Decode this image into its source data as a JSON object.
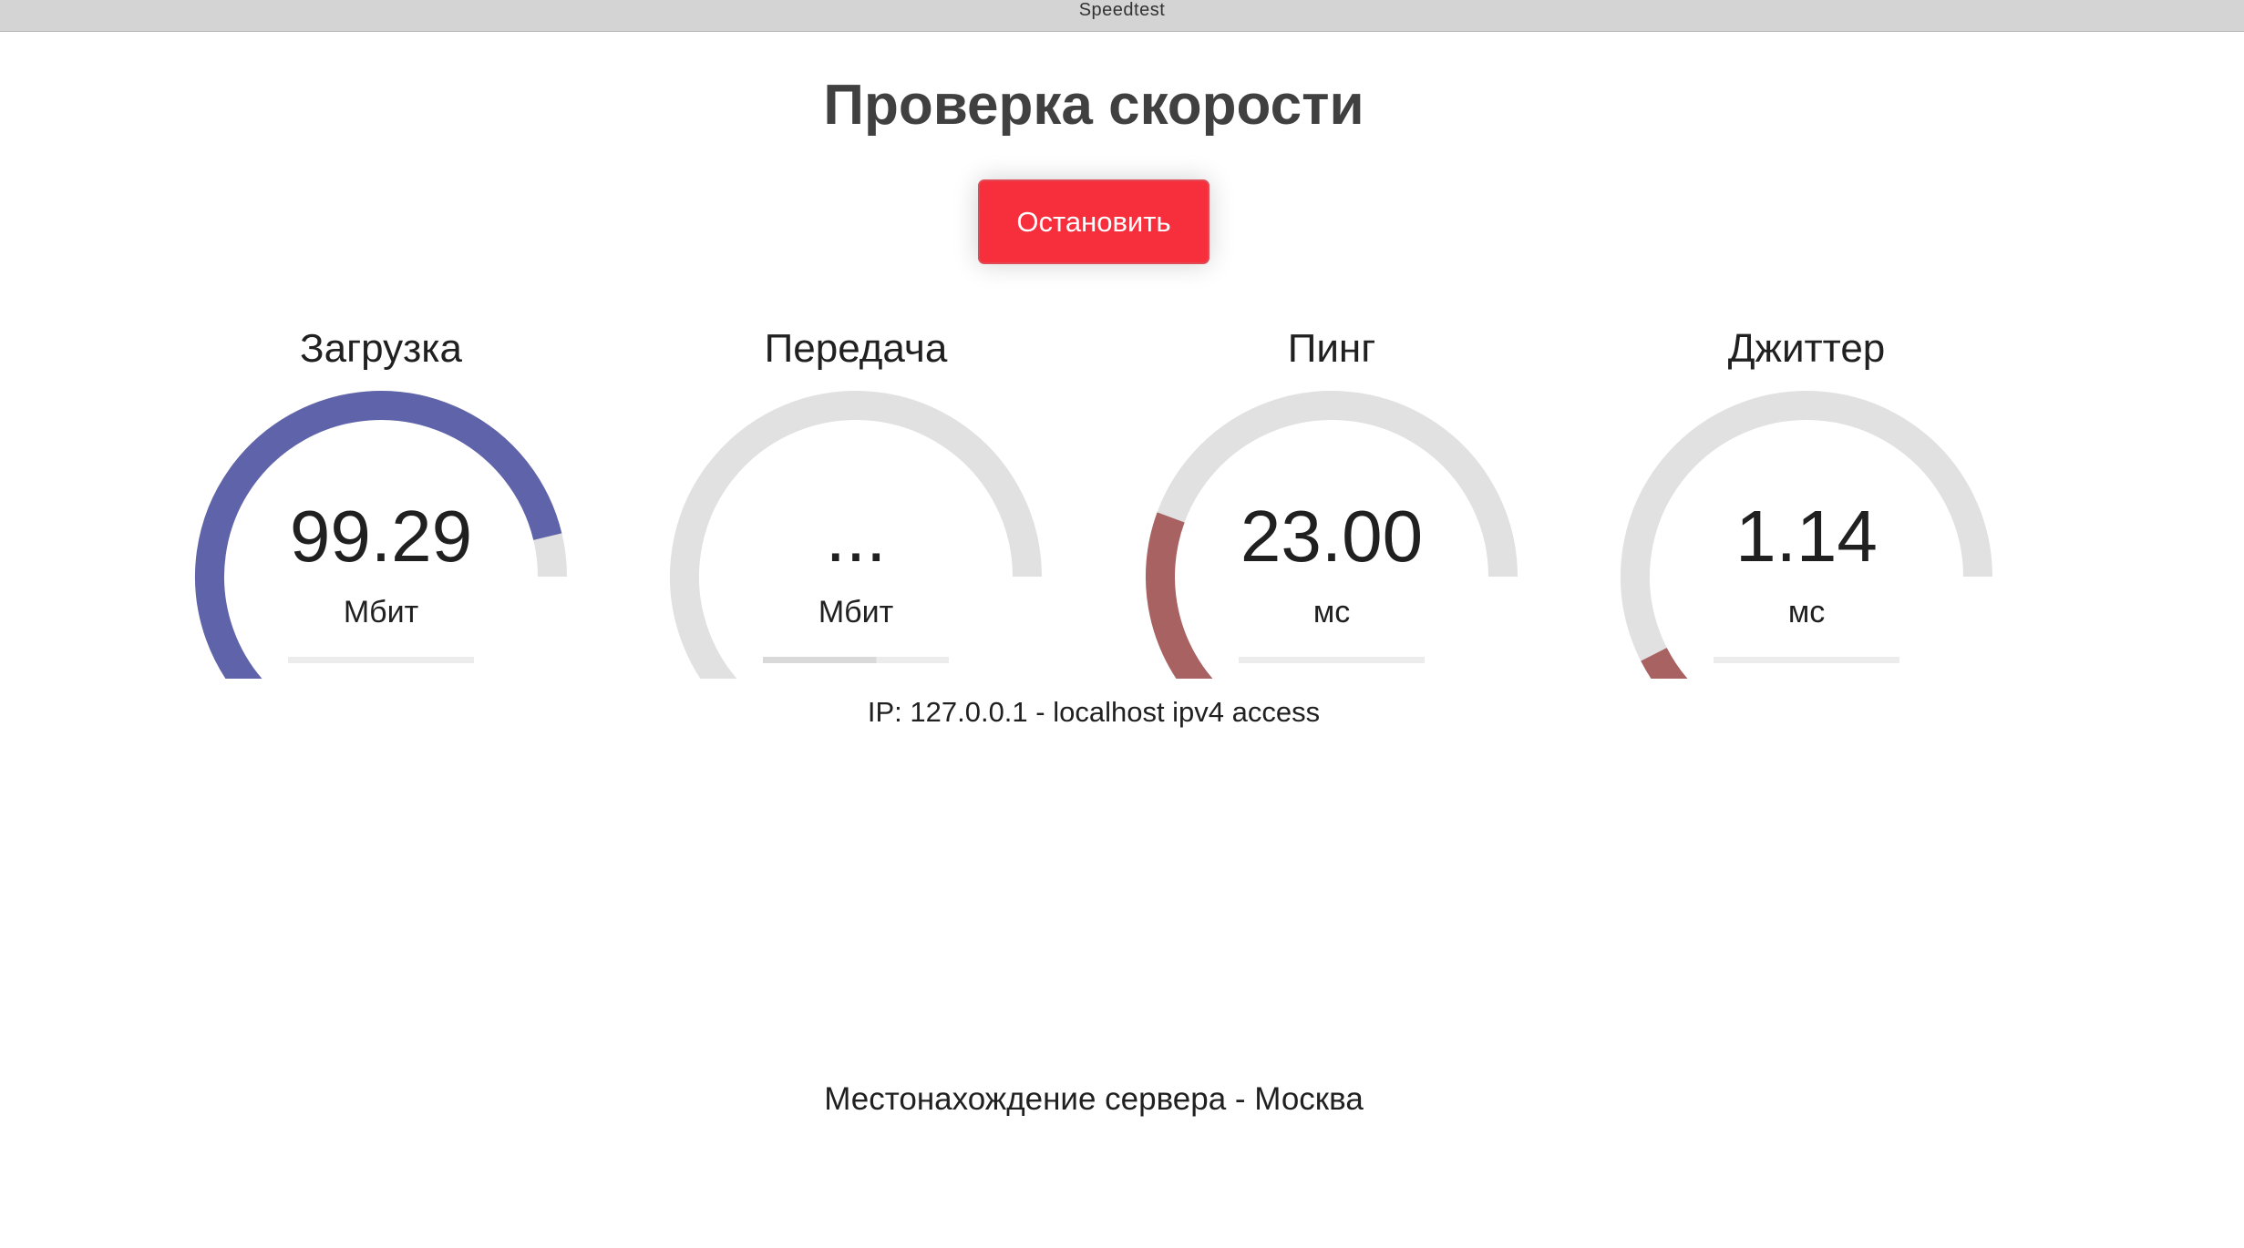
{
  "window": {
    "title": "Speedtest"
  },
  "page": {
    "title": "Проверка скорости",
    "stop_button_label": "Остановить",
    "ip_info": "IP: 127.0.0.1 - localhost ipv4 access",
    "server_location": "Местонахождение сервера - Москва"
  },
  "colors": {
    "download_arc": "#5f63a9",
    "ping_arc": "#a86262",
    "jitter_arc": "#a86262",
    "track": "#e1e1e1",
    "stop_button": "#f72e3c"
  },
  "gauges": [
    {
      "id": "download",
      "label": "Загрузка",
      "value": "99.29",
      "unit": "Мбит",
      "fill": 0.94,
      "color": "#5f63a9",
      "progress": 0
    },
    {
      "id": "upload",
      "label": "Передача",
      "value": "...",
      "unit": "Мбит",
      "fill": 0.0,
      "color": "#5f63a9",
      "progress": 0.61
    },
    {
      "id": "ping",
      "label": "Пинг",
      "value": "23.00",
      "unit": "мс",
      "fill": 0.29,
      "color": "#a86262",
      "progress": 0
    },
    {
      "id": "jitter",
      "label": "Джиттер",
      "value": "1.14",
      "unit": "мс",
      "fill": 0.08,
      "color": "#a86262",
      "progress": 0
    }
  ]
}
